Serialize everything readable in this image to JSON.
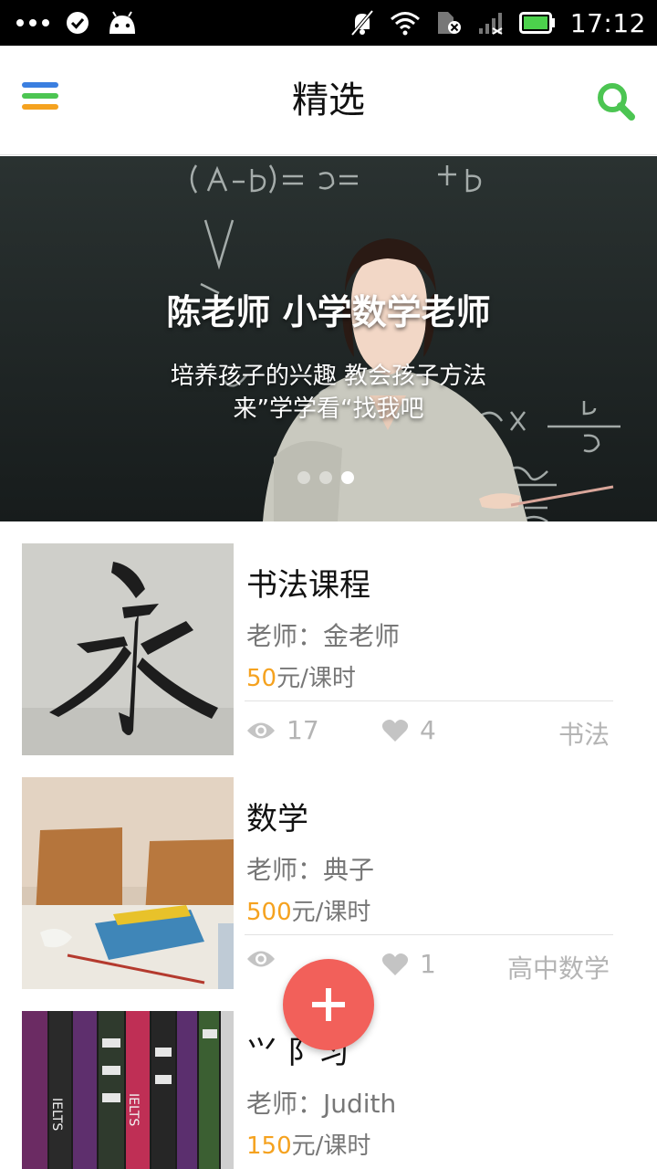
{
  "status_bar": {
    "time": "17:12",
    "icons": [
      "more-dots-icon",
      "check-circle-icon",
      "android-icon",
      "notifications-off-icon",
      "wifi-icon",
      "sim-off-icon",
      "signal-icon",
      "battery-icon"
    ]
  },
  "header": {
    "title": "精选",
    "menu_icon": "hamburger-menu-icon",
    "search_icon": "search-icon"
  },
  "banner": {
    "title": "陈老师 小学数学老师",
    "subtitle_line1": "培养孩子的兴趣 教会孩子方法",
    "subtitle_line2": "来”学学看“找我吧",
    "dots_count": 3,
    "active_dot": 2
  },
  "courses": [
    {
      "title": "书法课程",
      "teacher": "老师：金老师",
      "price": "50",
      "price_unit": "元/课时",
      "views": "17",
      "likes": "4",
      "tag": "书法"
    },
    {
      "title": "数学",
      "teacher": "老师：典子",
      "price": "500",
      "price_unit": "元/课时",
      "views": "",
      "likes": "1",
      "tag": "高中数学"
    },
    {
      "title": "⺍     ⻖习",
      "teacher": "老师：Judith",
      "price": "150",
      "price_unit": "元/课时"
    }
  ],
  "fab": {
    "icon": "plus-icon"
  },
  "colors": {
    "accent_green": "#4cc552",
    "price_orange": "#f5a21f",
    "fab_red": "#f2605a",
    "menu_blue": "#3b7fe0",
    "menu_green": "#4cc552",
    "menu_orange": "#f5a21f"
  }
}
